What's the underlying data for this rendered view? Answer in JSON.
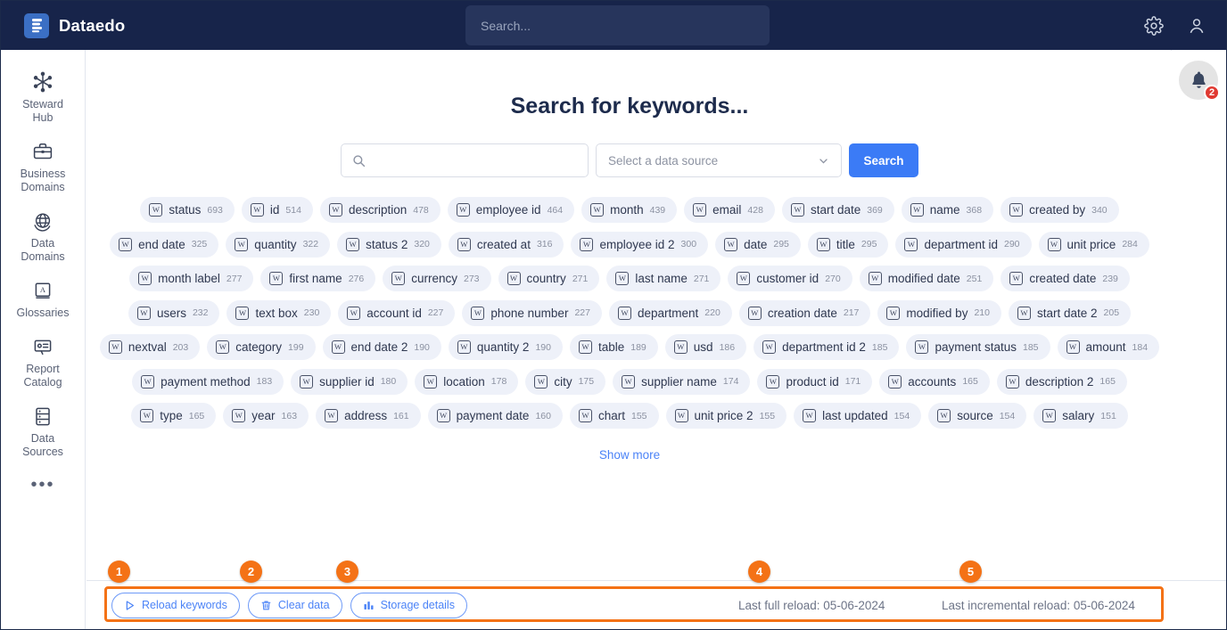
{
  "header": {
    "brand": "Dataedo",
    "logo_icon": "dataedo-logo-icon",
    "search_placeholder": "Search...",
    "settings_icon": "gear-icon",
    "account_icon": "user-icon"
  },
  "sidebar": {
    "items": [
      {
        "label": "Steward\nHub",
        "icon": "asterisk-hub-icon"
      },
      {
        "label": "Business\nDomains",
        "icon": "briefcase-icon"
      },
      {
        "label": "Data\nDomains",
        "icon": "globe-grid-icon"
      },
      {
        "label": "Glossaries",
        "icon": "book-a-icon"
      },
      {
        "label": "Report\nCatalog",
        "icon": "report-card-icon"
      },
      {
        "label": "Data\nSources",
        "icon": "database-rows-icon"
      }
    ],
    "more_label": "•••"
  },
  "notifications": {
    "icon": "bell-icon",
    "count": "2"
  },
  "main": {
    "title": "Search for keywords...",
    "keyword_input_value": "",
    "keyword_input_placeholder": "",
    "search_icon": "search-icon",
    "data_source_label": "Select a data source",
    "data_source_chevron": "chevron-down-icon",
    "search_button": "Search",
    "show_more": "Show more"
  },
  "keyword_rows": [
    [
      {
        "label": "status",
        "count": "693"
      },
      {
        "label": "id",
        "count": "514"
      },
      {
        "label": "description",
        "count": "478"
      },
      {
        "label": "employee id",
        "count": "464"
      },
      {
        "label": "month",
        "count": "439"
      },
      {
        "label": "email",
        "count": "428"
      },
      {
        "label": "start date",
        "count": "369"
      },
      {
        "label": "name",
        "count": "368"
      },
      {
        "label": "created by",
        "count": "340"
      }
    ],
    [
      {
        "label": "end date",
        "count": "325"
      },
      {
        "label": "quantity",
        "count": "322"
      },
      {
        "label": "status 2",
        "count": "320"
      },
      {
        "label": "created at",
        "count": "316"
      },
      {
        "label": "employee id 2",
        "count": "300"
      },
      {
        "label": "date",
        "count": "295"
      },
      {
        "label": "title",
        "count": "295"
      },
      {
        "label": "department id",
        "count": "290"
      },
      {
        "label": "unit price",
        "count": "284"
      }
    ],
    [
      {
        "label": "month label",
        "count": "277"
      },
      {
        "label": "first name",
        "count": "276"
      },
      {
        "label": "currency",
        "count": "273"
      },
      {
        "label": "country",
        "count": "271"
      },
      {
        "label": "last name",
        "count": "271"
      },
      {
        "label": "customer id",
        "count": "270"
      },
      {
        "label": "modified date",
        "count": "251"
      },
      {
        "label": "created date",
        "count": "239"
      }
    ],
    [
      {
        "label": "users",
        "count": "232"
      },
      {
        "label": "text box",
        "count": "230"
      },
      {
        "label": "account id",
        "count": "227"
      },
      {
        "label": "phone number",
        "count": "227"
      },
      {
        "label": "department",
        "count": "220"
      },
      {
        "label": "creation date",
        "count": "217"
      },
      {
        "label": "modified by",
        "count": "210"
      },
      {
        "label": "start date 2",
        "count": "205"
      }
    ],
    [
      {
        "label": "nextval",
        "count": "203"
      },
      {
        "label": "category",
        "count": "199"
      },
      {
        "label": "end date 2",
        "count": "190"
      },
      {
        "label": "quantity 2",
        "count": "190"
      },
      {
        "label": "table",
        "count": "189"
      },
      {
        "label": "usd",
        "count": "186"
      },
      {
        "label": "department id 2",
        "count": "185"
      },
      {
        "label": "payment status",
        "count": "185"
      },
      {
        "label": "amount",
        "count": "184"
      }
    ],
    [
      {
        "label": "payment method",
        "count": "183"
      },
      {
        "label": "supplier id",
        "count": "180"
      },
      {
        "label": "location",
        "count": "178"
      },
      {
        "label": "city",
        "count": "175"
      },
      {
        "label": "supplier name",
        "count": "174"
      },
      {
        "label": "product id",
        "count": "171"
      },
      {
        "label": "accounts",
        "count": "165"
      },
      {
        "label": "description 2",
        "count": "165"
      }
    ],
    [
      {
        "label": "type",
        "count": "165"
      },
      {
        "label": "year",
        "count": "163"
      },
      {
        "label": "address",
        "count": "161"
      },
      {
        "label": "payment date",
        "count": "160"
      },
      {
        "label": "chart",
        "count": "155"
      },
      {
        "label": "unit price 2",
        "count": "155"
      },
      {
        "label": "last updated",
        "count": "154"
      },
      {
        "label": "source",
        "count": "154"
      },
      {
        "label": "salary",
        "count": "151"
      }
    ]
  ],
  "bottom_bar": {
    "buttons": [
      {
        "label": "Reload keywords",
        "icon": "play-triangle-icon"
      },
      {
        "label": "Clear data",
        "icon": "trash-icon"
      },
      {
        "label": "Storage details",
        "icon": "bar-chart-icon"
      }
    ],
    "last_full_reload": "Last full reload: 05-06-2024",
    "last_incremental_reload": "Last incremental reload: 05-06-2024"
  },
  "annotations": {
    "color": "#f47216",
    "badges": [
      "1",
      "2",
      "3",
      "4",
      "5"
    ]
  },
  "colors": {
    "topbar": "#17244a",
    "accent_blue": "#3b7bf6",
    "annotation_orange": "#f47216",
    "badge_red": "#e03a32",
    "tag_bg": "#eef1f9"
  }
}
